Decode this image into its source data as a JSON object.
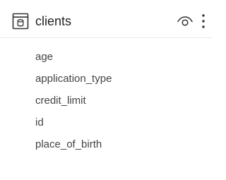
{
  "table": {
    "icon": "table-icon",
    "name": "clients"
  },
  "actions": {
    "visibility_icon": "eye-icon",
    "more_icon": "more-vertical-icon"
  },
  "columns": [
    "age",
    "application_type",
    "credit_limit",
    "id",
    "place_of_birth"
  ],
  "colors": {
    "text": "#444444",
    "title": "#222222",
    "icon": "#333333",
    "divider": "#e8e8e8"
  }
}
